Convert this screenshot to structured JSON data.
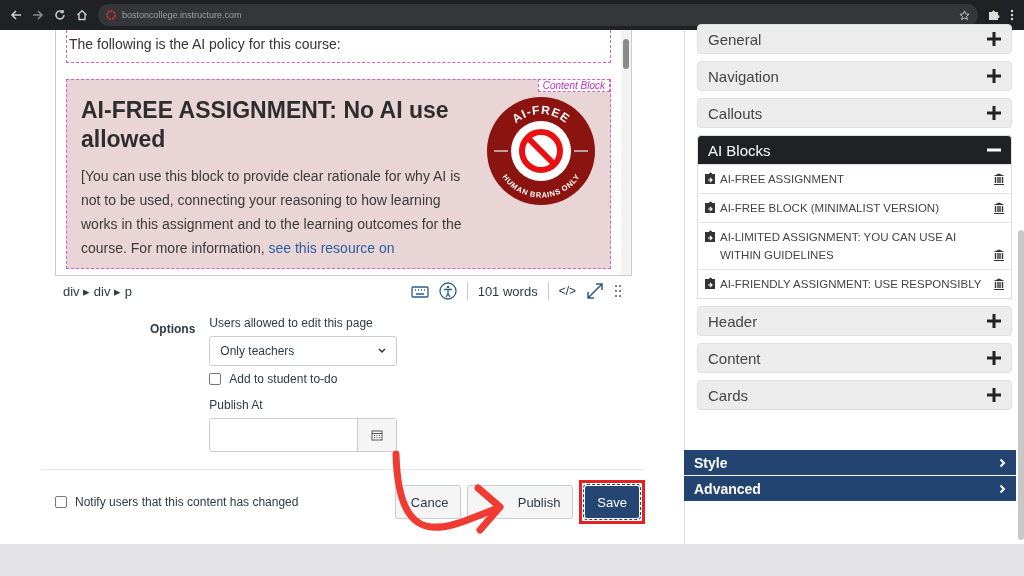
{
  "browser": {
    "url": "bostoncollege.instructure.com"
  },
  "editor": {
    "paragraph": "The following is the AI policy for this course:",
    "content_block": {
      "label": "Content Block",
      "heading": "AI-FREE ASSIGNMENT: No AI use allowed",
      "body": "[You can use this block to provide clear rationale for why AI is not to be used, connecting your reasoning to how learning works in this assignment and to the learning outcomes for the course. For more information, ",
      "link": "see this resource on",
      "badge_top": "AI-FREE",
      "badge_bottom": "HUMAN BRAINS ONLY"
    },
    "status": {
      "path": "div ▸ div ▸ p",
      "word_count": "101 words",
      "code_toggle": "</>"
    }
  },
  "options": {
    "label": "Options",
    "edit_permission": {
      "label": "Users allowed to edit this page",
      "value": "Only teachers"
    },
    "todo": {
      "label": "Add to student to-do",
      "checked": false
    },
    "publish_at": {
      "label": "Publish At"
    }
  },
  "footer": {
    "notify": {
      "label": "Notify users that this content has changed",
      "checked": false
    },
    "buttons": [
      {
        "label": "Cance",
        "kind": "secondary"
      },
      {
        "label": "Publish",
        "kind": "secondary"
      },
      {
        "label": "Save",
        "kind": "primary"
      }
    ]
  },
  "sidebar": {
    "sections": [
      {
        "label": "General",
        "expanded": false
      },
      {
        "label": "Navigation",
        "expanded": false
      },
      {
        "label": "Callouts",
        "expanded": false
      },
      {
        "label": "AI Blocks",
        "expanded": true,
        "items": [
          "AI-FREE ASSIGNMENT",
          "AI-FREE BLOCK (MINIMALIST VERSION)",
          "AI-LIMITED ASSIGNMENT: YOU CAN USE AI WITHIN GUIDELINES",
          "AI-FRIENDLY ASSIGNMENT: USE RESPONSIBLY"
        ]
      },
      {
        "label": "Header",
        "expanded": false
      },
      {
        "label": "Content",
        "expanded": false
      },
      {
        "label": "Cards",
        "expanded": false
      }
    ],
    "panels": [
      {
        "label": "Style"
      },
      {
        "label": "Advanced"
      }
    ]
  }
}
